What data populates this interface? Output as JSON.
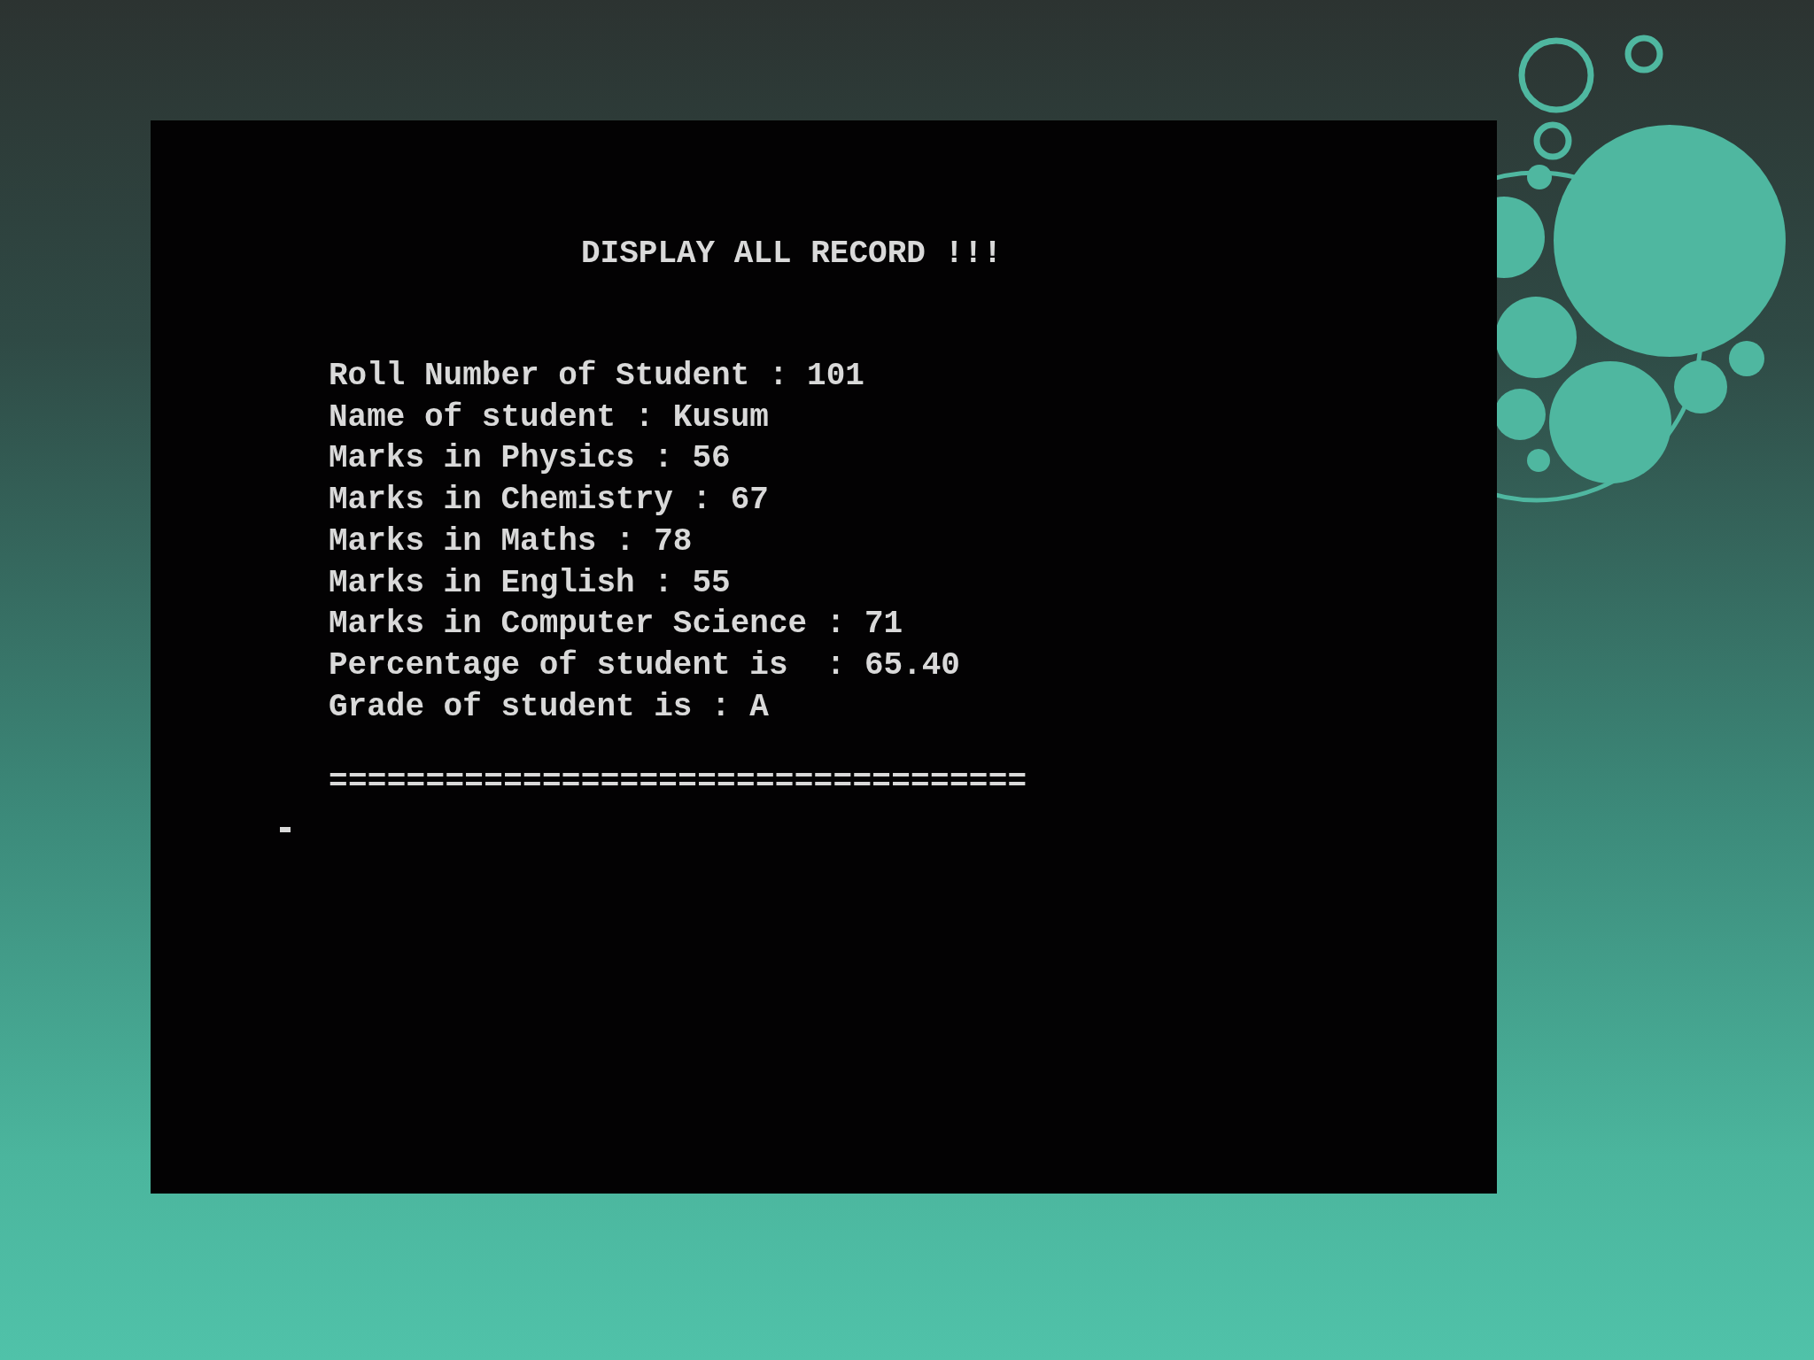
{
  "console": {
    "title": "DISPLAY ALL RECORD !!!",
    "lines": [
      "Roll Number of Student : 101",
      "Name of student : Kusum",
      "Marks in Physics : 56",
      "Marks in Chemistry : 67",
      "Marks in Maths : 78",
      "Marks in English : 55",
      "Marks in Computer Science : 71",
      "Percentage of student is  : 65.40",
      "Grade of student is : A"
    ],
    "separator": "====================================",
    "cursor": true
  }
}
